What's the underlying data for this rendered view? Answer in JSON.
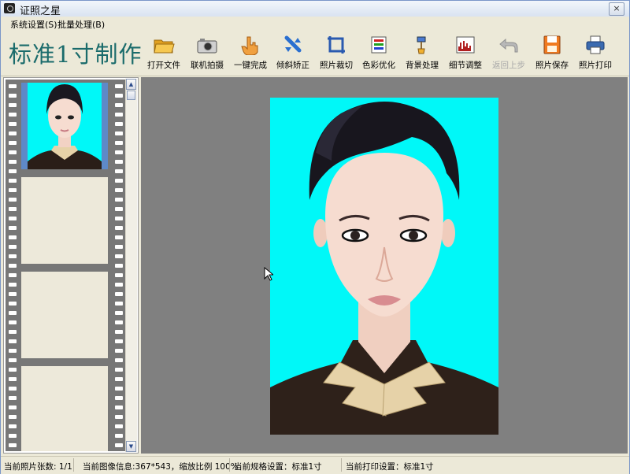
{
  "window": {
    "title": "证照之星",
    "close_label": "×"
  },
  "menu": [
    {
      "label": "系统设置(S)"
    },
    {
      "label": "批量处理(B)"
    }
  ],
  "toolbar": {
    "brand": "标准1寸制作",
    "tools": [
      {
        "label": "打开文件",
        "icon": "folder-open-icon",
        "enabled": true
      },
      {
        "label": "联机拍摄",
        "icon": "camera-icon",
        "enabled": true
      },
      {
        "label": "一键完成",
        "icon": "hand-click-icon",
        "enabled": true
      },
      {
        "label": "倾斜矫正",
        "icon": "rotate-correct-icon",
        "enabled": true
      },
      {
        "label": "照片裁切",
        "icon": "crop-icon",
        "enabled": true
      },
      {
        "label": "色彩优化",
        "icon": "color-palette-icon",
        "enabled": true
      },
      {
        "label": "背景处理",
        "icon": "brush-icon",
        "enabled": true
      },
      {
        "label": "细节调整",
        "icon": "histogram-icon",
        "enabled": true
      },
      {
        "label": "返回上步",
        "icon": "undo-icon",
        "enabled": false
      },
      {
        "label": "照片保存",
        "icon": "save-icon",
        "enabled": true
      },
      {
        "label": "照片打印",
        "icon": "printer-icon",
        "enabled": true
      }
    ]
  },
  "colors": {
    "photo_background": "#00f8f8",
    "canvas": "#808080",
    "selected_frame": "#5e89c8",
    "brand": "#1a6b6b"
  },
  "status": {
    "photo_count": "当前照片张数: 1/1",
    "image_info": "当前图像信息:367*543，缩放比例 100%",
    "spec_setting": "当前规格设置：标准1寸",
    "print_setting": "当前打印设置：标准1寸"
  }
}
